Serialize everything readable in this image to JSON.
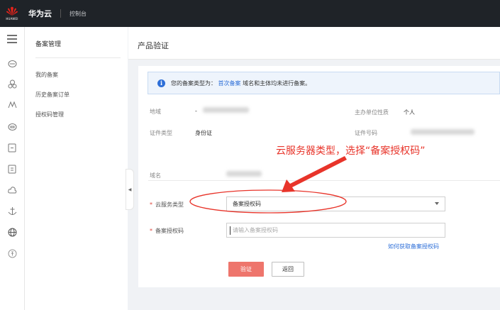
{
  "topbar": {
    "logo_word": "HUAWEI",
    "brand": "华为云",
    "console": "控制台"
  },
  "iconbar": {
    "items": [
      "menu-icon",
      "cloud-server-icon",
      "cluster-icon",
      "monitor-icon",
      "cloud-disk-icon",
      "document-icon",
      "database-icon",
      "cloud-icon",
      "anchor-icon",
      "globe-icon",
      "payment-icon"
    ]
  },
  "subnav": {
    "title": "备案管理",
    "items": [
      "我的备案",
      "历史备案订单",
      "授权码管理"
    ]
  },
  "page": {
    "title": "产品验证"
  },
  "info": {
    "icon": "i",
    "prefix": "您的备案类型为：",
    "link": "首次备案",
    "suffix": "域名和主体均未进行备案。"
  },
  "details": {
    "region_label": "地域",
    "region_value": "-",
    "org_type_label": "主办单位性质",
    "org_type_value": "个人",
    "cert_type_label": "证件类型",
    "cert_type_value": "身份证",
    "cert_no_label": "证件号码",
    "domain_label": "域名"
  },
  "form": {
    "service_type_label": "云服务类型",
    "service_type_value": "备案授权码",
    "auth_code_label": "备案授权码",
    "auth_code_placeholder": "请输入备案授权码",
    "auth_code_value": "",
    "get_code_link": "如何获取备案授权码",
    "verify_button": "验证",
    "back_button": "返回"
  },
  "annotation": {
    "text": "云服务器类型，选择“备案授权码”",
    "color": "#e8342a"
  },
  "colors": {
    "topbar_bg": "#1f2328",
    "primary_red": "#e9473c",
    "link_blue": "#2e6fd8",
    "info_bg": "#eef4fc"
  }
}
